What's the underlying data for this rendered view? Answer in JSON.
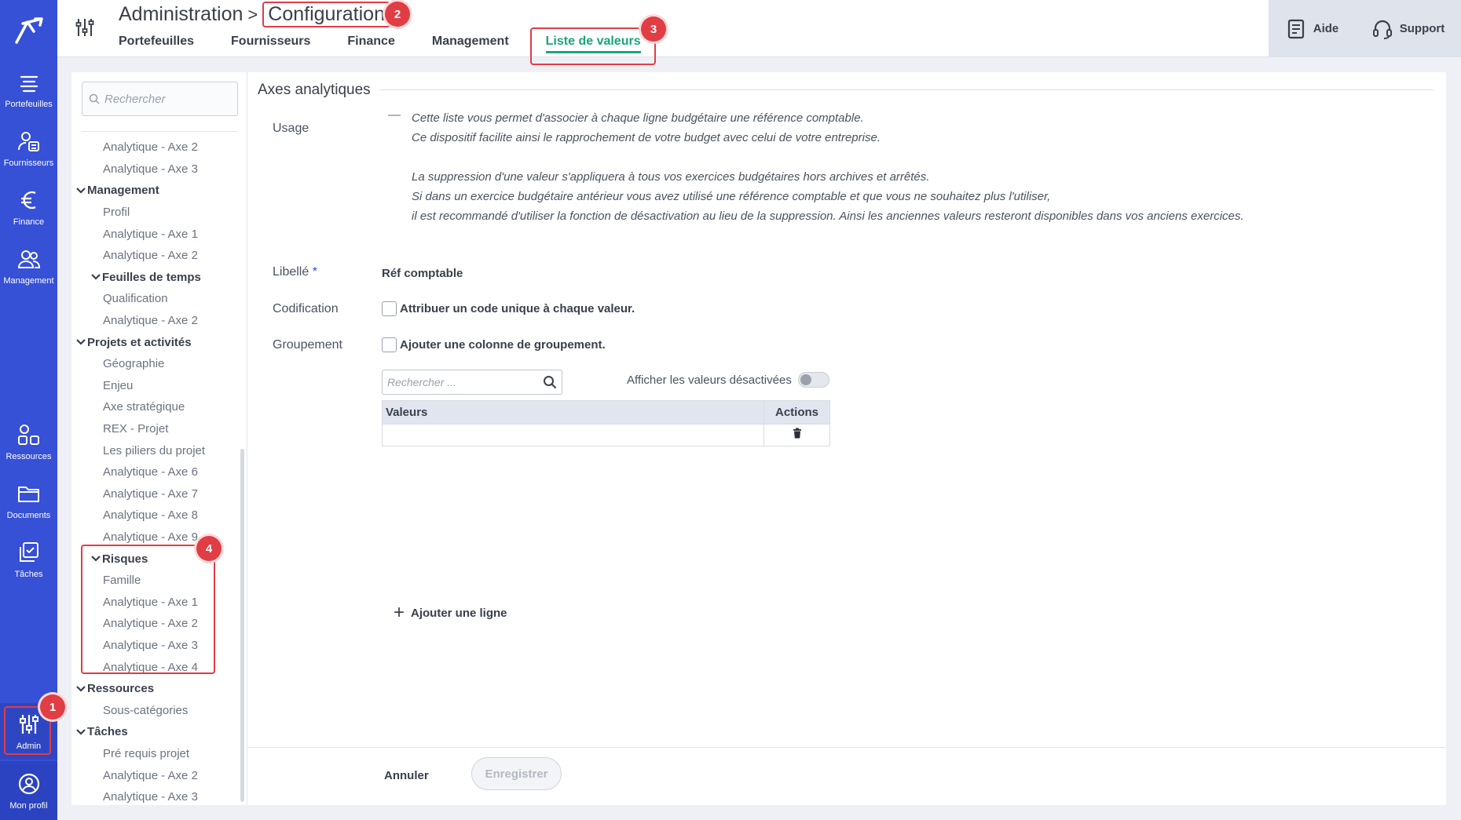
{
  "nav": {
    "items": [
      {
        "label": "Portefeuilles",
        "icon": "portfolio-icon"
      },
      {
        "label": "Fournisseurs",
        "icon": "suppliers-icon"
      },
      {
        "label": "Finance",
        "icon": "euro-icon"
      },
      {
        "label": "Management",
        "icon": "users-icon"
      },
      {
        "label": "Ressources",
        "icon": "resources-icon"
      },
      {
        "label": "Documents",
        "icon": "folder-icon"
      },
      {
        "label": "Tâches",
        "icon": "tasks-icon"
      },
      {
        "label": "Admin",
        "icon": "sliders-icon"
      },
      {
        "label": "Mon profil",
        "icon": "profile-icon"
      }
    ]
  },
  "header": {
    "breadcrumb_root": "Administration",
    "breadcrumb_sep": ">",
    "breadcrumb_current": "Configuration",
    "tabs": [
      "Portefeuilles",
      "Fournisseurs",
      "Finance",
      "Management",
      "Liste de valeurs"
    ],
    "active_tab": "Liste de valeurs",
    "help_label": "Aide",
    "support_label": "Support"
  },
  "markers": [
    "1",
    "2",
    "3",
    "4"
  ],
  "sidebar": {
    "search_placeholder": "Rechercher",
    "tree": [
      {
        "label": "Analytique - Axe 2",
        "level": 2
      },
      {
        "label": "Analytique - Axe 3",
        "level": 2
      },
      {
        "label": "Management",
        "level": 0,
        "group": true
      },
      {
        "label": "Profil",
        "level": 1
      },
      {
        "label": "Analytique - Axe 1",
        "level": 1
      },
      {
        "label": "Analytique - Axe 2",
        "level": 1
      },
      {
        "label": "Feuilles de temps",
        "level": 1,
        "group": true
      },
      {
        "label": "Qualification",
        "level": 2
      },
      {
        "label": "Analytique - Axe 2",
        "level": 2
      },
      {
        "label": "Projets et activités",
        "level": 0,
        "group": true
      },
      {
        "label": "Géographie",
        "level": 1
      },
      {
        "label": "Enjeu",
        "level": 1
      },
      {
        "label": "Axe stratégique",
        "level": 1
      },
      {
        "label": "REX - Projet",
        "level": 1
      },
      {
        "label": "Les piliers du projet",
        "level": 1
      },
      {
        "label": "Analytique - Axe 6",
        "level": 1
      },
      {
        "label": "Analytique - Axe 7",
        "level": 1
      },
      {
        "label": "Analytique - Axe 8",
        "level": 1
      },
      {
        "label": "Analytique - Axe 9",
        "level": 1
      },
      {
        "label": "Risques",
        "level": 1,
        "group": true
      },
      {
        "label": "Famille",
        "level": 2
      },
      {
        "label": "Analytique - Axe 1",
        "level": 2
      },
      {
        "label": "Analytique - Axe 2",
        "level": 2
      },
      {
        "label": "Analytique - Axe 3",
        "level": 2
      },
      {
        "label": "Analytique - Axe 4",
        "level": 2
      },
      {
        "label": "Ressources",
        "level": 0,
        "group": true
      },
      {
        "label": "Sous-catégories",
        "level": 1
      },
      {
        "label": "Tâches",
        "level": 0,
        "group": true
      },
      {
        "label": "Pré requis projet",
        "level": 1
      },
      {
        "label": "Analytique - Axe 2",
        "level": 1
      },
      {
        "label": "Analytique - Axe 3",
        "level": 1
      }
    ]
  },
  "main": {
    "section_title": "Axes analytiques",
    "usage_label": "Usage",
    "usage_dash": "—",
    "usage_lines": [
      "Cette liste vous permet d'associer à chaque ligne budgétaire une référence comptable.",
      "Ce dispositif facilite ainsi le rapprochement de votre budget avec celui de votre entreprise.",
      "",
      "La suppression d'une valeur s'appliquera à tous vos exercices budgétaires hors archives et arrêtés.",
      "Si dans un exercice budgétaire antérieur vous avez utilisé une référence comptable et que vous ne souhaitez plus l'utiliser,",
      "il est recommandé d'utiliser la fonction de désactivation au lieu de la suppression. Ainsi les anciennes valeurs resteront disponibles dans vos anciens exercices."
    ],
    "libelle_label": "Libellé",
    "required_mark": "*",
    "libelle_value": "Réf comptable",
    "codification_label": "Codification",
    "codification_checkbox": "Attribuer un code unique à chaque valeur.",
    "groupement_label": "Groupement",
    "groupement_checkbox": "Ajouter une colonne de groupement.",
    "values_search_placeholder": "Rechercher ...",
    "show_disabled_label": "Afficher les valeurs désactivées",
    "table_headers": [
      "Valeurs",
      "Actions"
    ],
    "add_line_label": "Ajouter une ligne",
    "cancel_label": "Annuler",
    "save_label": "Enregistrer"
  },
  "colors": {
    "nav_bg": "#3650d6",
    "accent_green": "#1aa57a",
    "marker_red": "#e03d45"
  }
}
